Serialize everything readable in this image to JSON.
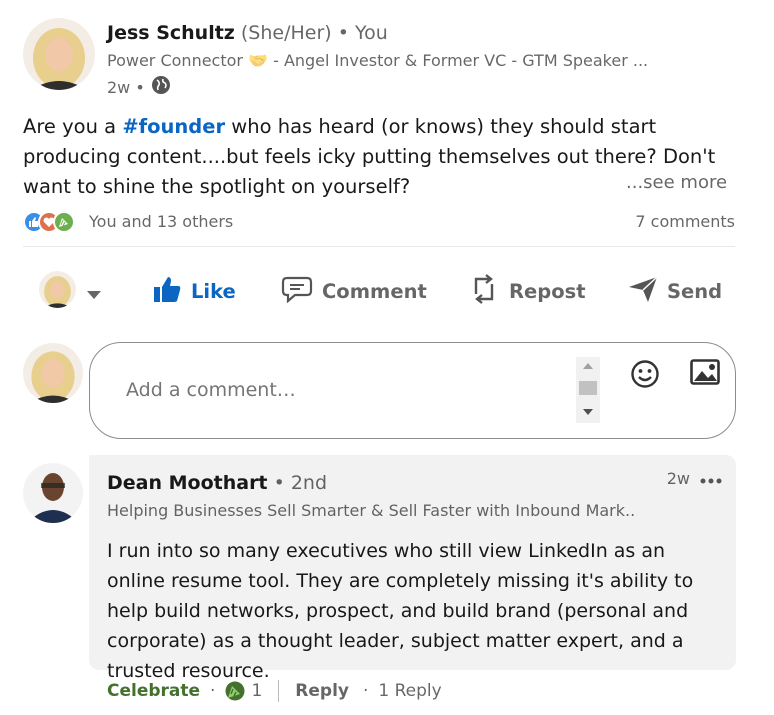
{
  "post": {
    "author_name": "Jess Schultz",
    "author_pronouns": "(She/Her)",
    "author_relation": "• You",
    "headline": "Power Connector 🤝 - Angel Investor & Former VC - GTM Speaker ...",
    "posted_time": "2w •",
    "visibility_icon": "globe-icon",
    "text_before_tag": "Are you a ",
    "hashtag": "#founder",
    "text_after_tag": " who has heard (or knows) they should start producing content....but feels icky putting themselves out there? Don't want to shine the spotlight on yourself?",
    "see_more": "...see more",
    "reactions_text": "You and 13 others",
    "comments_count": "7 comments"
  },
  "actions": {
    "like": "Like",
    "comment": "Comment",
    "repost": "Repost",
    "send": "Send"
  },
  "comment_box": {
    "placeholder": "Add a comment…"
  },
  "comment": {
    "author_name": "Dean Moothart",
    "degree": "• 2nd",
    "time": "2w",
    "headline": "Helping Businesses Sell Smarter & Sell Faster with Inbound Mark...",
    "text": "I run into so many executives who still view LinkedIn as an online resume tool. They are completely missing it's ability to help build networks, prospect, and build brand (personal and corporate) as a thought leader, subject matter expert, and a trusted resource.",
    "celebrate": "Celebrate",
    "reaction_count": "1",
    "reply": "Reply",
    "reply_count": "1 Reply"
  },
  "colors": {
    "brand_blue": "#0a66c2",
    "celebrate_green": "#44712e",
    "comment_bg": "#f2f2f2"
  }
}
